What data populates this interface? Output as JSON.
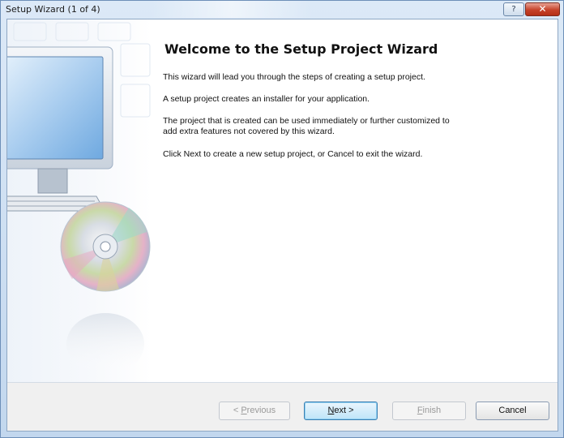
{
  "window": {
    "title": "Setup Wizard (1 of 4)",
    "help_symbol": "?",
    "close_symbol": "✕"
  },
  "content": {
    "heading": "Welcome to the Setup Project Wizard",
    "paragraphs": [
      "This wizard will lead you through the steps of creating a setup project.",
      "A setup project creates an installer for your application.",
      "The project that is created can be used immediately or further customized to",
      "add extra features not covered by this wizard.",
      "Click Next to create a new setup project, or Cancel to exit the wizard."
    ]
  },
  "buttons": {
    "previous": {
      "prefix": "< ",
      "accel": "P",
      "rest": "revious",
      "enabled": false
    },
    "next": {
      "accel": "N",
      "rest": "ext >",
      "enabled": true,
      "default": true
    },
    "finish": {
      "accel": "F",
      "rest": "inish",
      "enabled": false
    },
    "cancel": {
      "label": "Cancel",
      "enabled": true
    }
  },
  "icons": {
    "side_illustration": "computer-and-cd-illustration",
    "help": "help-icon",
    "close": "close-icon"
  }
}
